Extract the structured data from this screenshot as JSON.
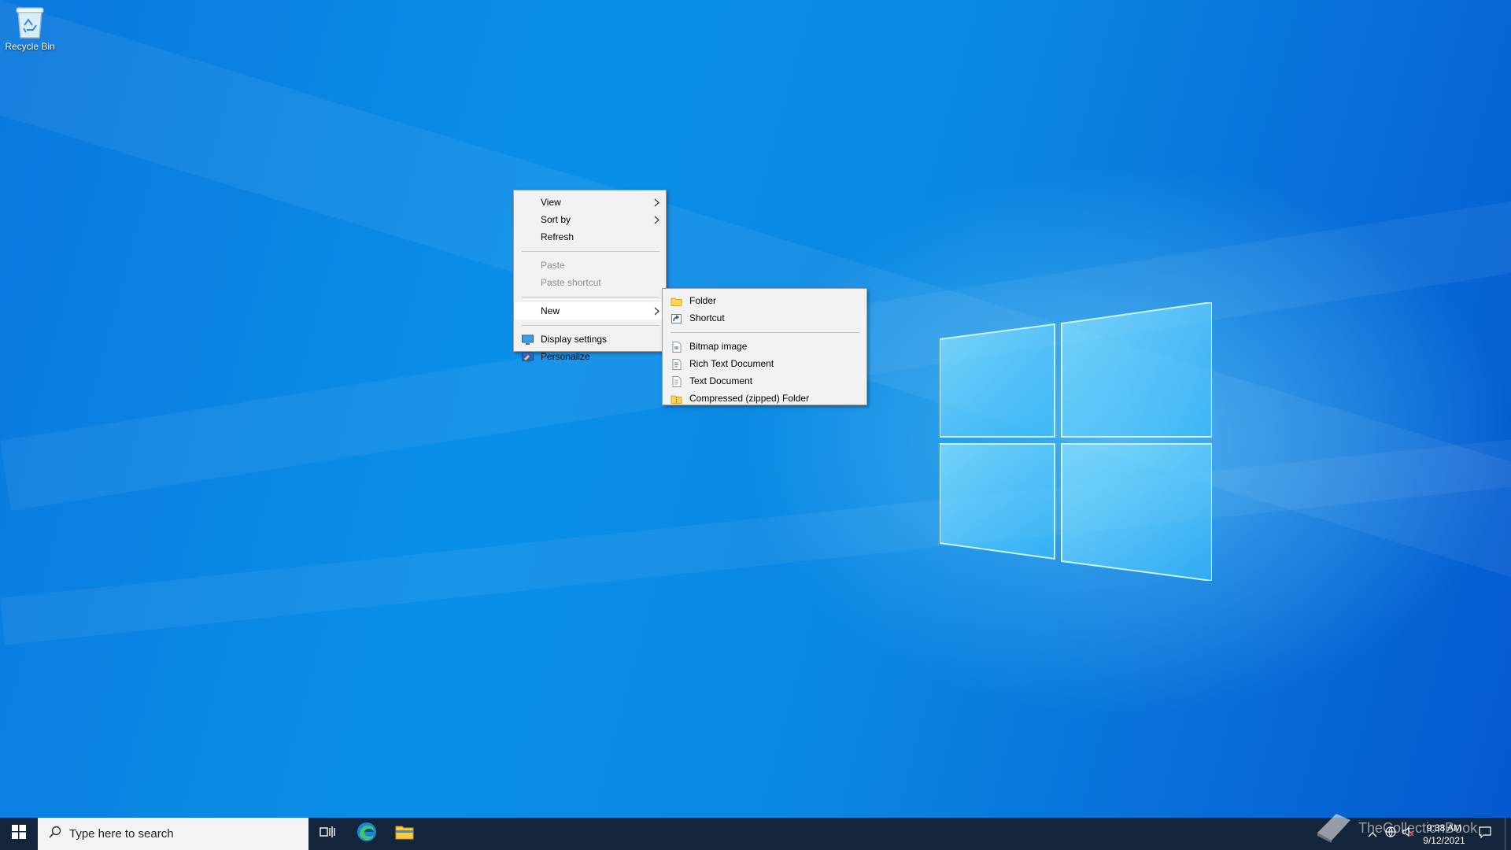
{
  "desktop": {
    "icons": [
      {
        "label": "Recycle Bin",
        "icon": "recycle-bin-icon"
      }
    ]
  },
  "context_menu": {
    "items": [
      {
        "label": "View",
        "has_submenu": true
      },
      {
        "label": "Sort by",
        "has_submenu": true
      },
      {
        "label": "Refresh"
      },
      {
        "label": "Paste",
        "disabled": true
      },
      {
        "label": "Paste shortcut",
        "disabled": true
      },
      {
        "label": "New",
        "has_submenu": true,
        "highlighted": true
      },
      {
        "label": "Display settings",
        "icon": "display-settings-icon"
      },
      {
        "label": "Personalize",
        "icon": "personalize-icon"
      }
    ]
  },
  "new_submenu": {
    "items": [
      {
        "label": "Folder",
        "icon": "folder-icon"
      },
      {
        "label": "Shortcut",
        "icon": "shortcut-icon"
      },
      {
        "label": "Bitmap image",
        "icon": "bitmap-image-icon"
      },
      {
        "label": "Rich Text Document",
        "icon": "rich-text-document-icon"
      },
      {
        "label": "Text Document",
        "icon": "text-document-icon"
      },
      {
        "label": "Compressed (zipped) Folder",
        "icon": "zip-folder-icon"
      }
    ]
  },
  "taskbar": {
    "search_placeholder": "Type here to search",
    "time": "9:38 AM",
    "date": "9/12/2021",
    "pinned": [
      "task-view-icon",
      "edge-icon",
      "file-explorer-icon"
    ]
  },
  "watermark": {
    "text": "TheCollectionBook"
  },
  "colors": {
    "desktop_accent": "#0a86e2",
    "taskbar": "#14243a",
    "menu_bg": "#f2f2f2"
  }
}
